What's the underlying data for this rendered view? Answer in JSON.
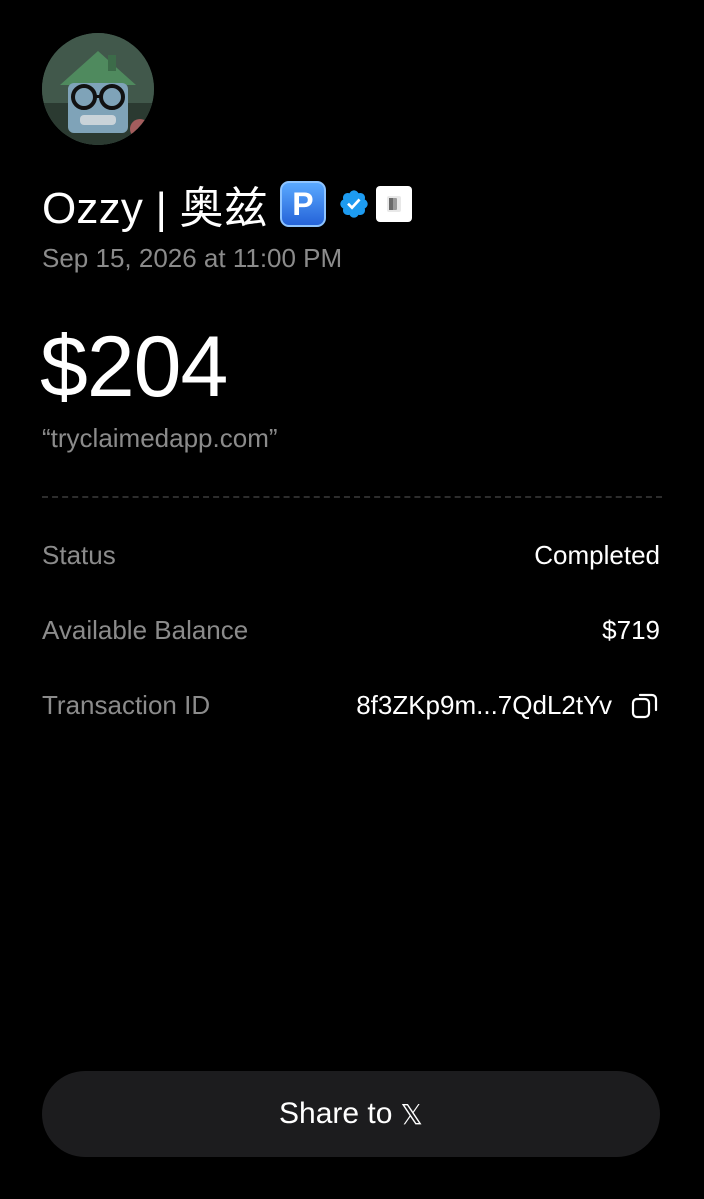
{
  "profile": {
    "name": "Ozzy | 奥兹",
    "emoji_badge": "P",
    "verified_icon": "verified-badge-icon",
    "affiliate_icon": "affiliate-badge-icon",
    "avatar_icon": "avatar-image"
  },
  "transaction": {
    "date": "Sep 15, 2026 at 11:00 PM",
    "amount": "$204",
    "memo": "“tryclaimedapp.com”"
  },
  "details": [
    {
      "label": "Status",
      "value": "Completed"
    },
    {
      "label": "Available Balance",
      "value": "$719"
    },
    {
      "label": "Transaction ID",
      "value": "8f3ZKp9m...7QdL2tYv"
    }
  ],
  "share": {
    "label": "Share to",
    "platform_glyph": "𝕏",
    "icon": "x-logo-icon"
  },
  "colors": {
    "background": "#000000",
    "text_primary": "#ffffff",
    "text_secondary": "#8b8b8b",
    "verified_blue": "#1d9bf0",
    "button_bg": "#1c1c1e"
  }
}
